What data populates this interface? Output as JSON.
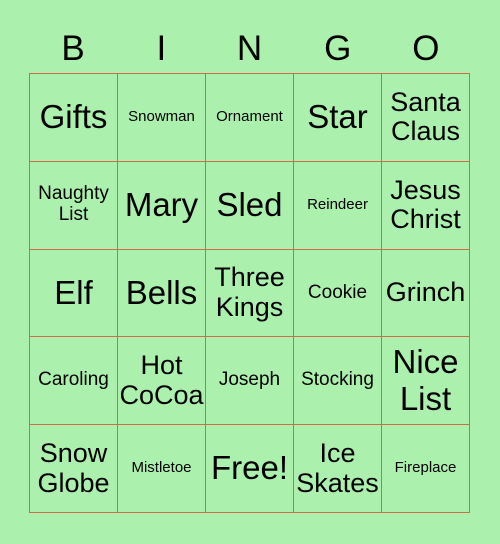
{
  "header": [
    "B",
    "I",
    "N",
    "G",
    "O"
  ],
  "colors": {
    "background": "#abf0ad",
    "border": "#d36a4c",
    "text": "#000000"
  },
  "cells": [
    {
      "text": "Gifts",
      "size": "s1"
    },
    {
      "text": "Snowman",
      "size": "s4"
    },
    {
      "text": "Ornament",
      "size": "s4"
    },
    {
      "text": "Star",
      "size": "s1"
    },
    {
      "text": "Santa Claus",
      "size": "s2"
    },
    {
      "text": "Naughty List",
      "size": "s3"
    },
    {
      "text": "Mary",
      "size": "s1"
    },
    {
      "text": "Sled",
      "size": "s1"
    },
    {
      "text": "Reindeer",
      "size": "s4"
    },
    {
      "text": "Jesus Christ",
      "size": "s2"
    },
    {
      "text": "Elf",
      "size": "s1"
    },
    {
      "text": "Bells",
      "size": "s1"
    },
    {
      "text": "Three Kings",
      "size": "s2"
    },
    {
      "text": "Cookie",
      "size": "s3"
    },
    {
      "text": "Grinch",
      "size": "s2"
    },
    {
      "text": "Caroling",
      "size": "s3"
    },
    {
      "text": "Hot CoCoa",
      "size": "s2"
    },
    {
      "text": "Joseph",
      "size": "s3"
    },
    {
      "text": "Stocking",
      "size": "s3"
    },
    {
      "text": "Nice List",
      "size": "s1"
    },
    {
      "text": "Snow Globe",
      "size": "s2"
    },
    {
      "text": "Mistletoe",
      "size": "s4"
    },
    {
      "text": "Free!",
      "size": "s1"
    },
    {
      "text": "Ice Skates",
      "size": "s2"
    },
    {
      "text": "Fireplace",
      "size": "s4"
    }
  ]
}
